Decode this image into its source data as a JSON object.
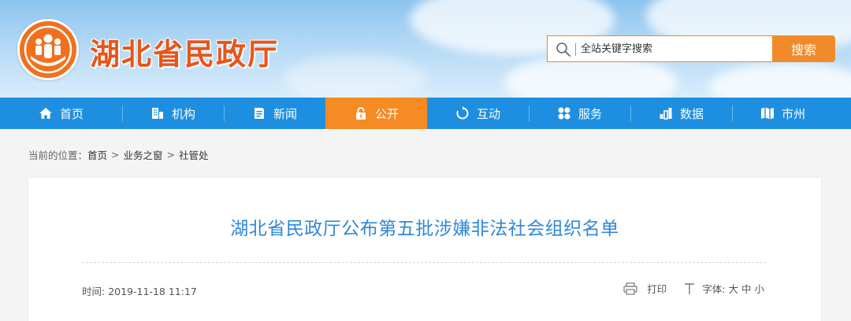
{
  "header": {
    "site_title": "湖北省民政厅",
    "logo_icon": "civil-affairs-emblem",
    "search": {
      "placeholder": "全站关键字搜索",
      "button_label": "搜索"
    }
  },
  "nav": {
    "items": [
      {
        "label": "首页",
        "icon": "home-icon"
      },
      {
        "label": "机构",
        "icon": "building-icon"
      },
      {
        "label": "新闻",
        "icon": "document-icon"
      },
      {
        "label": "公开",
        "icon": "lock-icon",
        "active": true
      },
      {
        "label": "互动",
        "icon": "refresh-icon"
      },
      {
        "label": "服务",
        "icon": "grid-icon"
      },
      {
        "label": "数据",
        "icon": "bar-chart-icon"
      },
      {
        "label": "市州",
        "icon": "map-icon"
      }
    ]
  },
  "breadcrumb": {
    "prefix": "当前的位置：",
    "items": [
      "首页",
      "业务之窗",
      "社管处"
    ],
    "separator": ">"
  },
  "article": {
    "title": "湖北省民政厅公布第五批涉嫌非法社会组织名单",
    "time_label": "时间:",
    "time_value": "2019-11-18 11:17",
    "print_label": "打印",
    "font_label": "字体:",
    "font_sizes": [
      "大",
      "中",
      "小"
    ]
  },
  "colors": {
    "nav_bg": "#1e8fe0",
    "nav_active": "#f68a23",
    "title_blue": "#2d88dc",
    "brand_orange": "#e8551a"
  }
}
